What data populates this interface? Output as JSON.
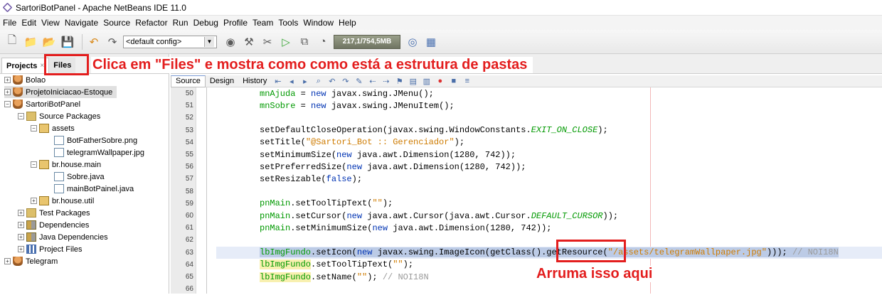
{
  "window": {
    "title": "SartoriBotPanel - Apache NetBeans IDE 11.0"
  },
  "menu": [
    "File",
    "Edit",
    "View",
    "Navigate",
    "Source",
    "Refactor",
    "Run",
    "Debug",
    "Profile",
    "Team",
    "Tools",
    "Window",
    "Help"
  ],
  "toolbar": {
    "config_value": "<default config>",
    "memory_label": "217,1/754,5MB"
  },
  "panel_tabs": {
    "projects": "Projects",
    "files": "Files",
    "close": "×"
  },
  "tree": [
    {
      "label": "Bolao"
    },
    {
      "label": "ProjetoIniciacao-Estoque"
    },
    {
      "label": "SartoriBotPanel"
    },
    {
      "label": "Source Packages"
    },
    {
      "label": "assets"
    },
    {
      "label": "BotFatherSobre.png"
    },
    {
      "label": "telegramWallpaper.jpg"
    },
    {
      "label": "br.house.main"
    },
    {
      "label": "Sobre.java"
    },
    {
      "label": "mainBotPainel.java"
    },
    {
      "label": "br.house.util"
    },
    {
      "label": "Test Packages"
    },
    {
      "label": "Dependencies"
    },
    {
      "label": "Java Dependencies"
    },
    {
      "label": "Project Files"
    },
    {
      "label": "Telegram"
    }
  ],
  "editor": {
    "tab_source": "Source",
    "tab_design": "Design",
    "tab_history": "History"
  },
  "code_lines": [
    {
      "n": "50",
      "t": "mnAjuda = new javax.swing.JMenu();"
    },
    {
      "n": "51",
      "t": "mnSobre = new javax.swing.JMenuItem();"
    },
    {
      "n": "52",
      "t": ""
    },
    {
      "n": "53",
      "t": "setDefaultCloseOperation(javax.swing.WindowConstants.EXIT_ON_CLOSE);"
    },
    {
      "n": "54",
      "t": "setTitle(\"@Sartori_Bot :: Gerenciador\");"
    },
    {
      "n": "55",
      "t": "setMinimumSize(new java.awt.Dimension(1280, 742));"
    },
    {
      "n": "56",
      "t": "setPreferredSize(new java.awt.Dimension(1280, 742));"
    },
    {
      "n": "57",
      "t": "setResizable(false);"
    },
    {
      "n": "58",
      "t": ""
    },
    {
      "n": "59",
      "t": "pnMain.setToolTipText(\"\");"
    },
    {
      "n": "60",
      "t": "pnMain.setCursor(new java.awt.Cursor(java.awt.Cursor.DEFAULT_CURSOR));"
    },
    {
      "n": "61",
      "t": "pnMain.setMinimumSize(new java.awt.Dimension(1280, 742));"
    },
    {
      "n": "62",
      "t": ""
    },
    {
      "n": "63",
      "t": "lbImgFundo.setIcon(new javax.swing.ImageIcon(getClass().getResource(\"/assets/telegramWallpaper.jpg\"))); // NOI18N"
    },
    {
      "n": "64",
      "t": "lbImgFundo.setToolTipText(\"\");"
    },
    {
      "n": "65",
      "t": "lbImgFundo.setName(\"\"); // NOI18N"
    },
    {
      "n": "66",
      "t": ""
    }
  ],
  "annotations": {
    "files_hint": "Clica em \"Files\" e mostra como como está a estrutura de pastas",
    "fix_hint": "Arruma isso aqui"
  },
  "colors": {
    "annotation": "#e31e1e",
    "keyword": "#0033b3",
    "string": "#ce7b00"
  }
}
